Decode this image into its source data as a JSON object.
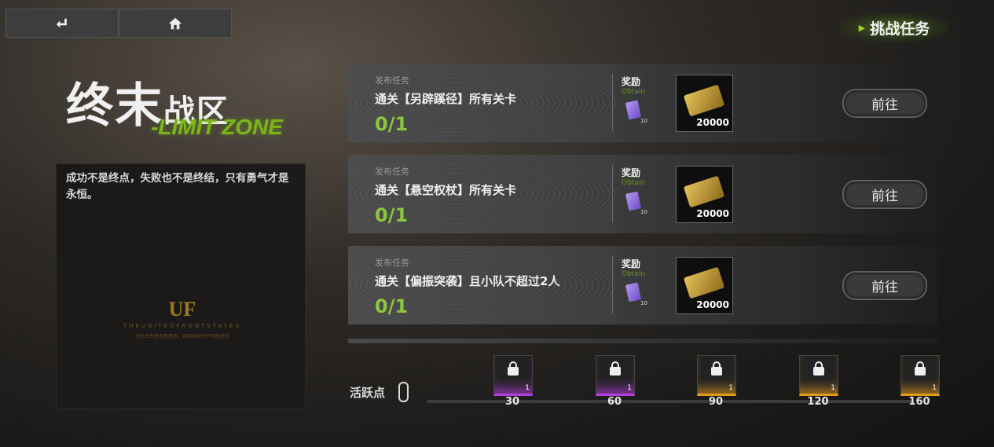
{
  "nav": {
    "back_icon": "back-arrow-icon",
    "home_icon": "home-icon"
  },
  "challenge": {
    "label": "挑战任务"
  },
  "zone": {
    "title_big": "终末",
    "title_small": "战区",
    "subtitle": "-LIMIT ZONE"
  },
  "description": {
    "text": "成功不是终点，失败也不是终结，只有勇气才是永恒。"
  },
  "logo": {
    "mark": "UF",
    "line1": "THEUNITEDFRONTSTATES",
    "line2": "为先王先贤无畏而变，奔而前则为不可能变可"
  },
  "tasks": [
    {
      "tag": "发布任务",
      "title": "通关【另辟蹊径】所有关卡",
      "progress": "0/1",
      "reward_label": "奖励",
      "obtain": "Obtain",
      "ticket_qty": "10",
      "reward_amount": "20000",
      "go": "前往"
    },
    {
      "tag": "发布任务",
      "title": "通关【悬空权杖】所有关卡",
      "progress": "0/1",
      "reward_label": "奖励",
      "obtain": "Obtain",
      "ticket_qty": "10",
      "reward_amount": "20000",
      "go": "前往"
    },
    {
      "tag": "发布任务",
      "title": "通关【偏振突袭】且小队不超过2人",
      "progress": "0/1",
      "reward_label": "奖励",
      "obtain": "Obtain",
      "ticket_qty": "10",
      "reward_amount": "20000",
      "go": "前往"
    }
  ],
  "activity": {
    "label": "活跃点",
    "milestones": [
      {
        "value": "30",
        "count": "1",
        "rarity": "purple"
      },
      {
        "value": "60",
        "count": "1",
        "rarity": "purple"
      },
      {
        "value": "90",
        "count": "1",
        "rarity": "orange"
      },
      {
        "value": "120",
        "count": "1",
        "rarity": "orange"
      },
      {
        "value": "160",
        "count": "1",
        "rarity": "orange"
      }
    ]
  },
  "colors": {
    "accent_green": "#8cc63e",
    "purple": "#b33de0",
    "orange": "#e09a1c"
  }
}
